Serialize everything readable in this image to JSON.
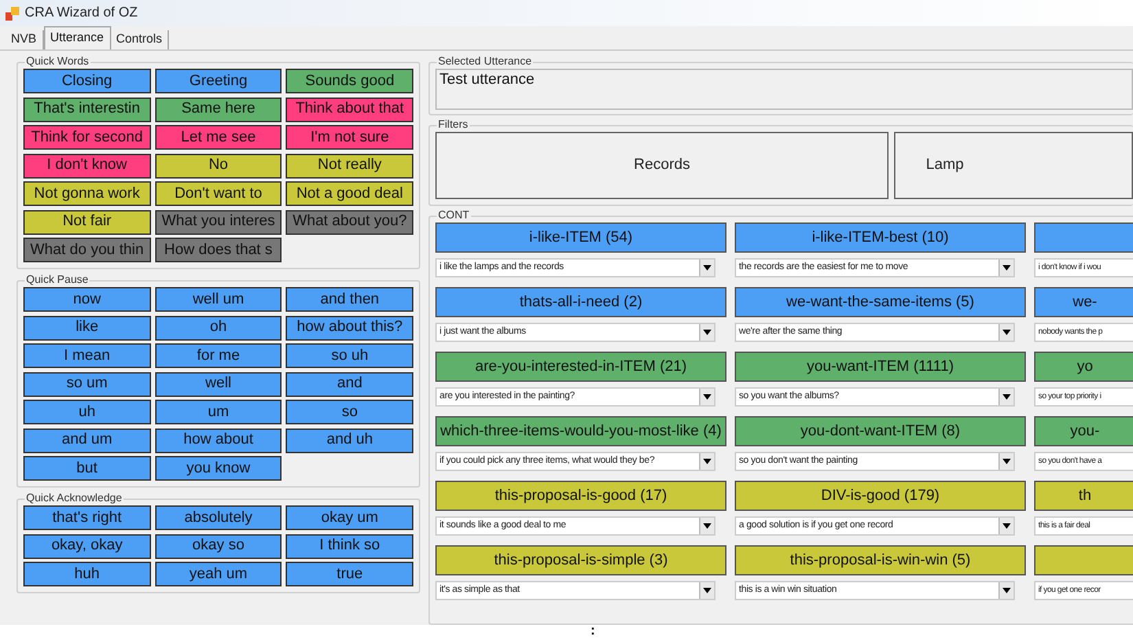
{
  "window": {
    "title": "CRA Wizard of OZ"
  },
  "tabs": [
    {
      "label": "NVB",
      "selected": false
    },
    {
      "label": "Utterance",
      "selected": true
    },
    {
      "label": "Controls",
      "selected": false
    }
  ],
  "quick_words": {
    "title": "Quick Words",
    "buttons": [
      {
        "label": "Closing",
        "color": "#4d9ef5"
      },
      {
        "label": "Greeting",
        "color": "#4d9ef5"
      },
      {
        "label": "Sounds good",
        "color": "#5fb06b"
      },
      {
        "label": "That's interestin",
        "color": "#5fb06b"
      },
      {
        "label": "Same here",
        "color": "#5fb06b"
      },
      {
        "label": "Think about that",
        "color": "#fe3e7e"
      },
      {
        "label": "Think for second",
        "color": "#fe3e7e"
      },
      {
        "label": "Let me see",
        "color": "#fe3e7e"
      },
      {
        "label": "I'm not sure",
        "color": "#fe3e7e"
      },
      {
        "label": "I don't know",
        "color": "#fe3e7e"
      },
      {
        "label": "No",
        "color": "#c8c83a"
      },
      {
        "label": "Not really",
        "color": "#c8c83a"
      },
      {
        "label": "Not gonna work",
        "color": "#c8c83a"
      },
      {
        "label": "Don't want to",
        "color": "#c8c83a"
      },
      {
        "label": "Not a good deal",
        "color": "#c8c83a"
      },
      {
        "label": "Not fair",
        "color": "#c8c83a"
      },
      {
        "label": "What you interes",
        "color": "#777777"
      },
      {
        "label": "What about you?",
        "color": "#777777"
      },
      {
        "label": "What do you thin",
        "color": "#777777"
      },
      {
        "label": "How does that s",
        "color": "#777777"
      }
    ]
  },
  "quick_pause": {
    "title": "Quick Pause",
    "buttons": [
      {
        "label": "now",
        "color": "#4d9ef5"
      },
      {
        "label": "well um",
        "color": "#4d9ef5"
      },
      {
        "label": "and then",
        "color": "#4d9ef5"
      },
      {
        "label": "like",
        "color": "#4d9ef5"
      },
      {
        "label": "oh",
        "color": "#4d9ef5"
      },
      {
        "label": "how about this?",
        "color": "#4d9ef5"
      },
      {
        "label": "I mean",
        "color": "#4d9ef5"
      },
      {
        "label": "for me",
        "color": "#4d9ef5"
      },
      {
        "label": "so uh",
        "color": "#4d9ef5"
      },
      {
        "label": "so um",
        "color": "#4d9ef5"
      },
      {
        "label": "well",
        "color": "#4d9ef5"
      },
      {
        "label": "and",
        "color": "#4d9ef5"
      },
      {
        "label": "uh",
        "color": "#4d9ef5"
      },
      {
        "label": "um",
        "color": "#4d9ef5"
      },
      {
        "label": "so",
        "color": "#4d9ef5"
      },
      {
        "label": "and um",
        "color": "#4d9ef5"
      },
      {
        "label": "how about",
        "color": "#4d9ef5"
      },
      {
        "label": "and uh",
        "color": "#4d9ef5"
      },
      {
        "label": "but",
        "color": "#4d9ef5"
      },
      {
        "label": "you know",
        "color": "#4d9ef5"
      }
    ]
  },
  "quick_acknowledge": {
    "title": "Quick Acknowledge",
    "buttons": [
      {
        "label": "that's right",
        "color": "#4d9ef5"
      },
      {
        "label": "absolutely",
        "color": "#4d9ef5"
      },
      {
        "label": "okay um",
        "color": "#4d9ef5"
      },
      {
        "label": "okay, okay",
        "color": "#4d9ef5"
      },
      {
        "label": "okay so",
        "color": "#4d9ef5"
      },
      {
        "label": "I think so",
        "color": "#4d9ef5"
      },
      {
        "label": "huh",
        "color": "#4d9ef5"
      },
      {
        "label": "yeah um",
        "color": "#4d9ef5"
      },
      {
        "label": "true",
        "color": "#4d9ef5"
      }
    ]
  },
  "selected_utterance": {
    "title": "Selected Utterance",
    "value": "Test utterance"
  },
  "filters": {
    "title": "Filters",
    "buttons": [
      "Records",
      "Lamp"
    ]
  },
  "cont": {
    "title": "CONT",
    "items": [
      {
        "label": "i-like-ITEM (54)",
        "color": "#4d9ef5",
        "option": "i like the lamps and the records"
      },
      {
        "label": "i-like-ITEM-best (10)",
        "color": "#4d9ef5",
        "option": "the records are the easiest for me to move"
      },
      {
        "color": "#4d9ef5",
        "option": "i don't know if i wou"
      },
      {
        "label": "thats-all-i-need (2)",
        "color": "#4d9ef5",
        "option": "i just want the albums"
      },
      {
        "label": "we-want-the-same-items (5)",
        "color": "#4d9ef5",
        "option": "we're after the same thing"
      },
      {
        "label": "we-",
        "color": "#4d9ef5",
        "option": "nobody wants the p"
      },
      {
        "label": "are-you-interested-in-ITEM (21)",
        "color": "#5fb06b",
        "option": "are you interested in the painting?"
      },
      {
        "label": "you-want-ITEM (1111)",
        "color": "#5fb06b",
        "option": "so you want the albums?"
      },
      {
        "label": "yo",
        "color": "#5fb06b",
        "option": "so your top priority i"
      },
      {
        "label": "which-three-items-would-you-most-like (4)",
        "color": "#5fb06b",
        "option": "if you could pick any three items, what would they be?"
      },
      {
        "label": "you-dont-want-ITEM (8)",
        "color": "#5fb06b",
        "option": "so you don't want the painting"
      },
      {
        "label": "you-",
        "color": "#5fb06b",
        "option": "so you don't have a"
      },
      {
        "label": "this-proposal-is-good (17)",
        "color": "#c8c83a",
        "option": "it sounds like a good deal to me"
      },
      {
        "label": "DIV-is-good (179)",
        "color": "#c8c83a",
        "option": "a good solution is if you get one record"
      },
      {
        "label": "th",
        "color": "#c8c83a",
        "option": "this is a fair deal"
      },
      {
        "label": "this-proposal-is-simple (3)",
        "color": "#c8c83a",
        "option": "it's as simple as that"
      },
      {
        "label": "this-proposal-is-win-win (5)",
        "color": "#c8c83a",
        "option": "this is a win win situation"
      },
      {
        "color": "#c8c83a",
        "option": "if you get one recor"
      }
    ]
  },
  "stray_mark": ":"
}
